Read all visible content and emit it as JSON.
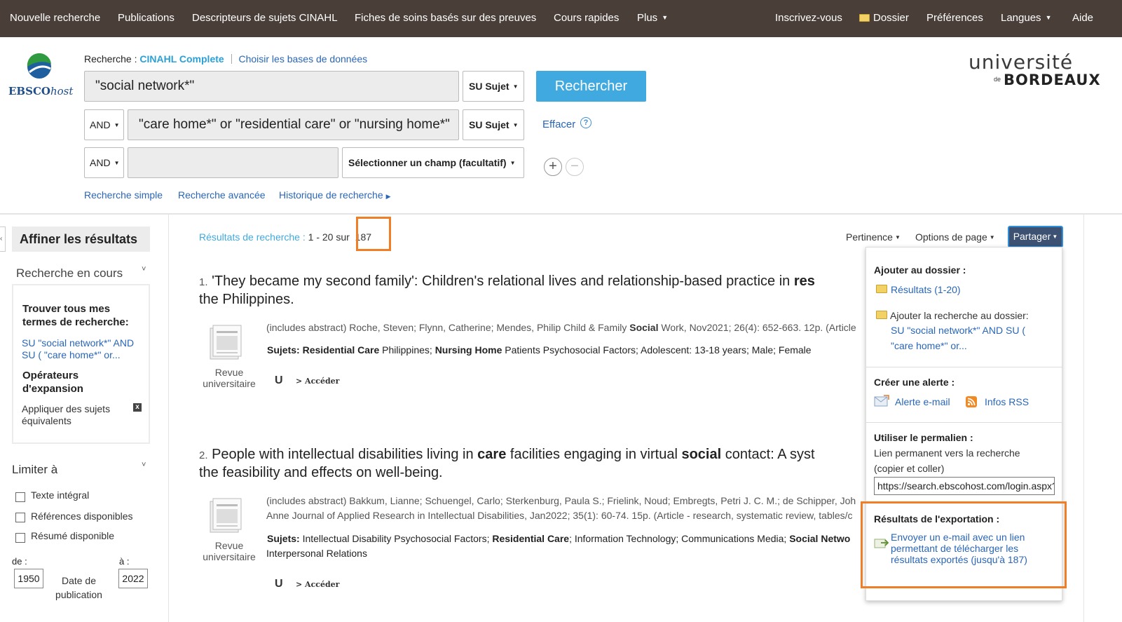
{
  "topnav": {
    "left": [
      "Nouvelle recherche",
      "Publications",
      "Descripteurs de sujets CINAHL",
      "Fiches de soins basés sur des preuves",
      "Cours rapides",
      "Plus"
    ],
    "right": {
      "signin": "Inscrivez-vous",
      "folder": "Dossier",
      "prefs": "Préférences",
      "langs": "Langues",
      "help": "Aide"
    }
  },
  "logo": {
    "ebsco": "EBSCO",
    "host": "host"
  },
  "search": {
    "label": "Recherche :",
    "database": "CINAHL Complete",
    "choose_db": "Choisir les bases de données",
    "rows": [
      {
        "bool": "",
        "value": "\"social network*\"",
        "field": "SU Sujet"
      },
      {
        "bool": "AND",
        "value": "\"care home*\" or \"residential care\" or \"nursing home*\"",
        "field": "SU Sujet"
      },
      {
        "bool": "AND",
        "value": "",
        "field": "Sélectionner un champ (facultatif)"
      }
    ],
    "button": "Rechercher",
    "clear": "Effacer",
    "help": "?",
    "add": "+",
    "remove": "−",
    "links": {
      "basic": "Recherche simple",
      "advanced": "Recherche avancée",
      "history": "Historique de recherche"
    }
  },
  "university": {
    "line1": "université",
    "de": "de",
    "line2": "BORDEAUX"
  },
  "sidebar": {
    "refine": "Affiner les résultats",
    "current": "Recherche en cours",
    "find_all": "Trouver tous mes termes de recherche:",
    "query_link": "SU \"social network*\" AND SU ( \"care home*\" or...",
    "expanders": "Opérateurs d'expansion",
    "apply_equiv": "Appliquer des sujets équivalents",
    "remove_x": "x",
    "limit": "Limiter à",
    "checks": [
      "Texte intégral",
      "Références disponibles",
      "Résumé disponible"
    ],
    "from_label": "de :",
    "to_label": "à :",
    "from": "1950",
    "to": "2022",
    "date_label": "Date de publication"
  },
  "results": {
    "prefix": "Résultats de recherche :",
    "range": "1 - 20 sur",
    "total": "187",
    "sort": "Pertinence",
    "page_options": "Options de page",
    "share": "Partager",
    "items": [
      {
        "num": "1.",
        "title_pre": "'They became my second family': Children's relational lives and relationship-based practice in ",
        "title_bold": "res",
        "title_line2": "the Philippines.",
        "meta_pre": "(includes abstract) Roche, Steven; Flynn, Catherine; Mendes, Philip Child & Family ",
        "meta_bold": "Social",
        "meta_post": " Work, Nov2021; 26(4): 652-663. 12p. (Article",
        "subjects_label": "Sujets:",
        "s1": "Residential Care",
        "s2": " Philippines; ",
        "s3": "Nursing Home",
        "s4": " Patients Psychosocial Factors; Adolescent: 13-18 years; Male; Female",
        "doc_label": "Revue universitaire",
        "access": "> Accéder",
        "u": "U"
      },
      {
        "num": "2.",
        "title_a": "People with intellectual disabilities living in ",
        "title_b": "care",
        "title_c": " facilities engaging in virtual ",
        "title_d": "social",
        "title_e": " contact: A syst",
        "title_line2": "the feasibility and effects on well-being.",
        "meta_line1": "(includes abstract) Bakkum, Lianne; Schuengel, Carlo; Sterkenburg, Paula S.; Frielink, Noud; Embregts, Petri J. C. M.; de Schipper, Joh",
        "meta_line2": "Anne Journal of Applied Research in Intellectual Disabilities, Jan2022; 35(1): 60-74. 15p. (Article - research, systematic review, tables/c",
        "subjects_label": "Sujets:",
        "s1": " Intellectual Disability Psychosocial Factors; ",
        "s2": "Residential Care",
        "s3": "; Information Technology; Communications Media; ",
        "s4": "Social Netwo",
        "subjects_line2": "Interpersonal Relations",
        "doc_label": "Revue universitaire",
        "access": "> Accéder",
        "u": "U"
      }
    ]
  },
  "share_panel": {
    "add_folder": "Ajouter au dossier :",
    "results_link": "Résultats (1-20)",
    "add_search": "Ajouter la recherche au dossier:",
    "search_link_1": "SU \"social network*\" AND SU (",
    "search_link_2": "\"care home*\" or...",
    "alert": "Créer une alerte :",
    "email_alert": "Alerte e-mail",
    "rss": "Infos RSS",
    "permalink": "Utiliser le permalien :",
    "perm_desc_1": "Lien permanent vers la recherche",
    "perm_desc_2": "(copier et coller)",
    "perm_url": "https://search.ebscohost.com/login.aspx?direct=true",
    "export": "Résultats de l'exportation :",
    "export_link_1": "Envoyer un e-mail avec un lien",
    "export_link_2": "permettant de télécharger les",
    "export_link_3": "résultats exportés (jusqu'à 187)"
  },
  "colors": {
    "topbar": "#4a3e38",
    "accent": "#3fa9e0",
    "highlight": "#f07e26",
    "share": "#3d5172"
  }
}
